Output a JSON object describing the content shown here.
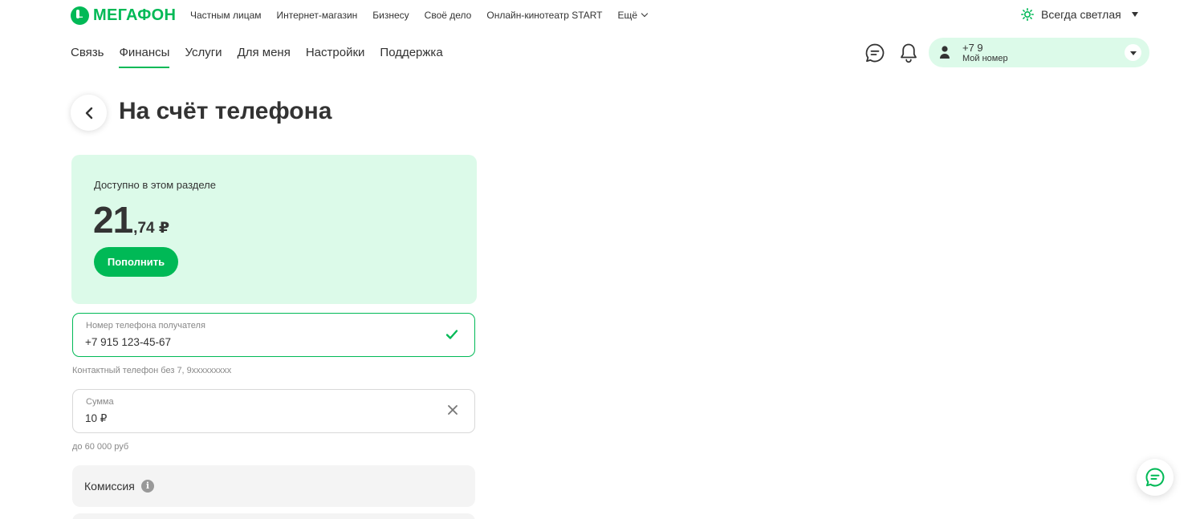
{
  "brand": {
    "name": "МегаФон",
    "accent": "#00b956",
    "accent_light": "#dcfae9"
  },
  "topnav": {
    "items": [
      {
        "label": "Частным лицам"
      },
      {
        "label": "Интернет-магазин"
      },
      {
        "label": "Бизнесу"
      },
      {
        "label": "Своё дело"
      },
      {
        "label": "Онлайн-кинотеатр START"
      }
    ],
    "more_label": "Ещё",
    "theme_label": "Всегда светлая"
  },
  "mainnav": {
    "items": [
      {
        "label": "Связь",
        "active": false
      },
      {
        "label": "Финансы",
        "active": true
      },
      {
        "label": "Услуги",
        "active": false
      },
      {
        "label": "Для меня",
        "active": false
      },
      {
        "label": "Настройки",
        "active": false
      },
      {
        "label": "Поддержка",
        "active": false
      }
    ]
  },
  "header_icons": {
    "chat": "chat-icon",
    "notifications": "bell-icon"
  },
  "profile": {
    "number": "+7 9",
    "subtitle": "Мой номер"
  },
  "page": {
    "title": "На счёт телефона"
  },
  "balance": {
    "label": "Доступно в этом разделе",
    "integer": "21",
    "fraction": ",74 ₽",
    "topup_label": "Пополнить"
  },
  "phone_field": {
    "label": "Номер телефона получателя",
    "value": "+7 915 123-45-67",
    "hint": "Контактный телефон без 7, 9xxxxxxxxx",
    "status_icon": "check-icon"
  },
  "sum_field": {
    "label": "Сумма",
    "value": "10 ₽",
    "hint": "до 60 000 руб",
    "clear_icon": "close-icon"
  },
  "commission": {
    "label": "Комиссия",
    "info_glyph": "i"
  }
}
